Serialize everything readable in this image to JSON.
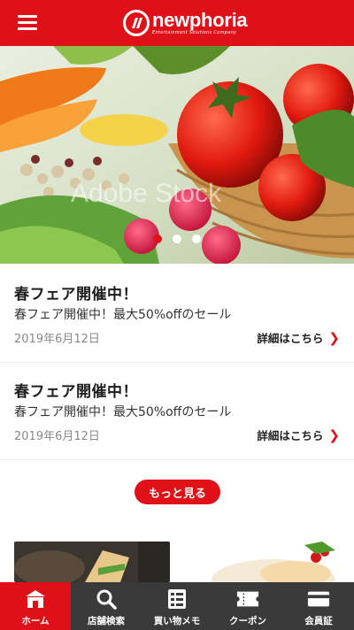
{
  "header": {
    "logo_name": "newphoria",
    "logo_tagline": "Entertainment Solutions Company"
  },
  "hero": {
    "watermark": "Adobe Stock",
    "slides": 3,
    "active_slide": 0
  },
  "news": [
    {
      "title": "春フェア開催中！",
      "description": "春フェア開催中！最大50%offのセール",
      "date": "2019年6月12日",
      "link": "詳細はこちら"
    },
    {
      "title": "春フェア開催中！",
      "description": "春フェア開催中！最大50%offのセール",
      "date": "2019年6月12日",
      "link": "詳細はこちら"
    }
  ],
  "more_button": "もっと見る",
  "tabs": [
    {
      "label": "ホーム",
      "icon": "home-icon",
      "active": true
    },
    {
      "label": "店舗検索",
      "icon": "search-icon",
      "active": false
    },
    {
      "label": "買い物メモ",
      "icon": "memo-icon",
      "active": false
    },
    {
      "label": "クーポン",
      "icon": "coupon-icon",
      "active": false
    },
    {
      "label": "会員証",
      "icon": "member-card-icon",
      "active": false
    }
  ],
  "colors": {
    "brand_red": "#e01018",
    "tabbar_bg": "#3a3a3a"
  }
}
